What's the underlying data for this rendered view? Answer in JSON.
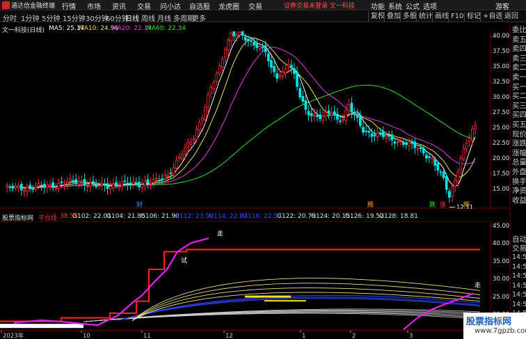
{
  "titlebar": {
    "app_title": "通达信金融终端",
    "menus": [
      "行情",
      "市场",
      "资讯",
      "交易"
    ],
    "menus2": [
      "问小达",
      "自选股",
      "龙虎圈",
      "交易"
    ],
    "promo": "证券交易未登录  文一科技",
    "right_menus": [
      "功能",
      "系统",
      "公式",
      "选项"
    ],
    "guest": "游客"
  },
  "toolbar": {
    "periods": [
      "分时",
      "1分钟",
      "5分钟",
      "15分钟",
      "30分钟",
      "60分钟",
      "日线",
      "周线",
      "月线",
      "多周期",
      "更多"
    ],
    "active_period": "日线",
    "right_buttons": [
      "复权",
      "叠加",
      "多股",
      "统计",
      "画线",
      "F10",
      "标记",
      "+自选",
      "返回"
    ]
  },
  "main_chart": {
    "stock_label": "文一科技(日线)",
    "ma_labels": [
      {
        "text": "MA5: 25.17",
        "color": "#ffffff"
      },
      {
        "text": "MA10: 24.96",
        "color": "#f0e060"
      },
      {
        "text": "MA20: 22.17",
        "color": "#e040e0"
      },
      {
        "text": "MA60: 22.34",
        "color": "#30e030"
      }
    ],
    "high_label": "42.34",
    "low_label": "12.11",
    "y_ticks": [
      "40.00",
      "37.50",
      "35.00",
      "32.50",
      "30.00",
      "27.50",
      "25.00",
      "22.50",
      "20.00",
      "17.50",
      "15.00"
    ],
    "events": [
      {
        "text": "财",
        "color": "#4090ff"
      },
      {
        "text": "腾",
        "color": "#ffa000"
      },
      {
        "text": "跌",
        "color": "#30e030"
      },
      {
        "text": "涨",
        "color": "#ff4040"
      },
      {
        "text": "腾",
        "color": "#ffa000"
      }
    ]
  },
  "sub_chart": {
    "name": "股票指标网",
    "indicator_name": "平台线",
    "indicator_value": "38.58",
    "g_labels": [
      {
        "text": "G102: 22.01",
        "color": "#e0e0e0"
      },
      {
        "text": "G104: 21.85",
        "color": "#e0e0e0"
      },
      {
        "text": "G106: 21.90",
        "color": "#e0e0e0"
      },
      {
        "text": "G112: 23.50",
        "color": "#3050ff"
      },
      {
        "text": "G114: 22.87",
        "color": "#3050ff"
      },
      {
        "text": "G116: 22.57",
        "color": "#3050ff"
      },
      {
        "text": "G122: 20.79",
        "color": "#e0e0e0"
      },
      {
        "text": "G124: 20.15",
        "color": "#e0e0e0"
      },
      {
        "text": "G126: 19.52",
        "color": "#e0e0e0"
      },
      {
        "text": "G128: 18.81",
        "color": "#e0e0e0"
      }
    ],
    "y_ticks": [
      "45.00",
      "40.00",
      "35.00",
      "30.00",
      "25.00",
      "20.00"
    ],
    "marks": [
      "走",
      "试",
      "走"
    ]
  },
  "x_axis": {
    "labels": [
      "2023年",
      "10",
      "11",
      "12",
      "1",
      "2",
      "3",
      "4"
    ]
  },
  "sidebar_main": [
    "委比",
    "卖五",
    "卖四",
    "卖三",
    "卖二",
    "卖一",
    "买一",
    "买二",
    "买三",
    "买四",
    "买五",
    "现价",
    "涨跌",
    "涨幅",
    "总量",
    "外盘",
    "换手",
    "净资",
    "收益"
  ],
  "sidebar_sub": [
    "自动",
    "交易"
  ],
  "sidebar_times": [
    "14:5",
    "14:5",
    "14:5",
    "14:5",
    "14:5",
    "14:5",
    "14:5",
    "14:5"
  ],
  "watermark": {
    "line1": "股票指标网",
    "line2": "www.7gpzb.com"
  },
  "colors": {
    "up": "#ff3030",
    "down": "#00e0e0",
    "ma5": "#ffffff",
    "ma10": "#f0e060",
    "ma20": "#e040e0",
    "ma60": "#30e030",
    "platform": "#ff2020"
  }
}
